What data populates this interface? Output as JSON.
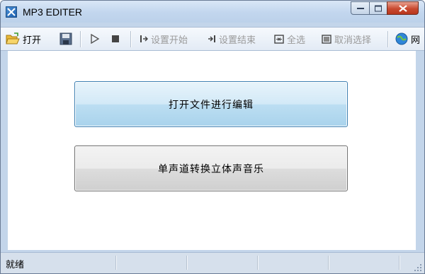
{
  "window": {
    "title": "MP3 EDITER"
  },
  "toolbar": {
    "open_label": "打开",
    "set_start_label": "设置开始",
    "set_end_label": "设置结束",
    "select_all_label": "全选",
    "cancel_select_label": "取消选择",
    "web_label": "网"
  },
  "main": {
    "open_edit_button": "打开文件进行编辑",
    "mono_to_stereo_button": "单声道转换立体声音乐"
  },
  "statusbar": {
    "status_text": "就绪"
  },
  "colors": {
    "accent_border": "#3c7fb1",
    "title_bar": "#c2d6ee",
    "close_button": "#c94a30"
  }
}
